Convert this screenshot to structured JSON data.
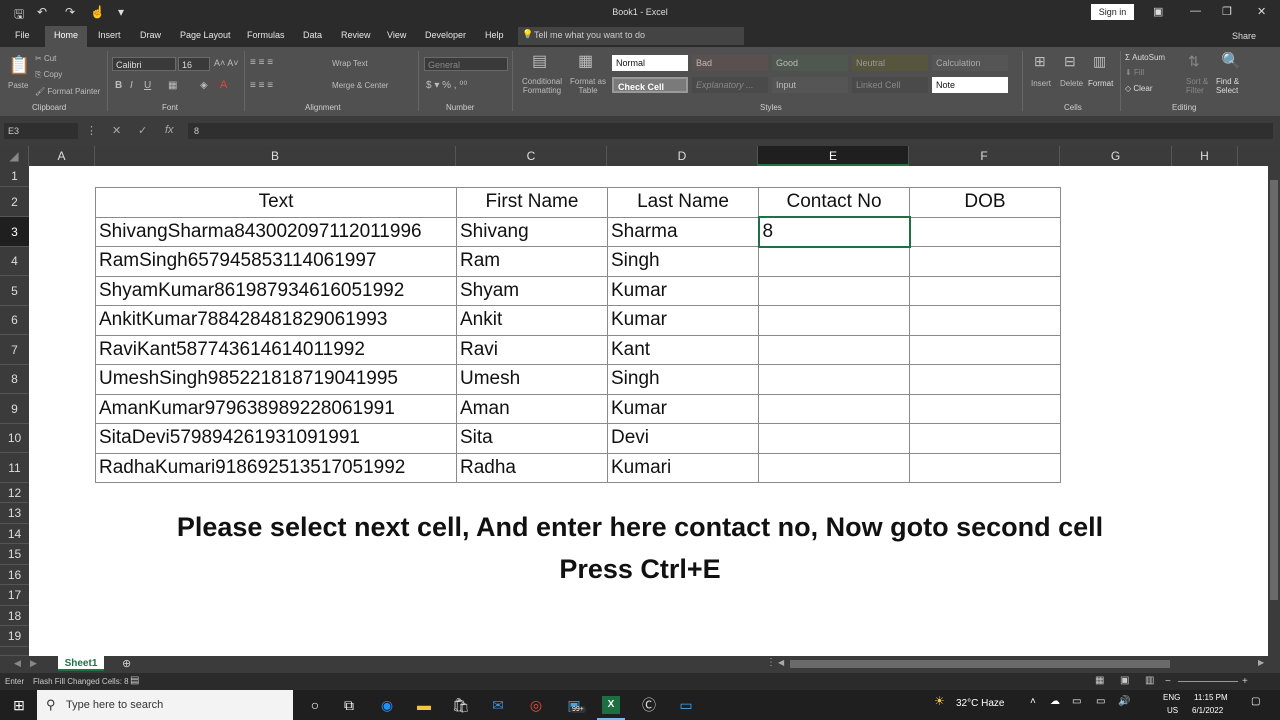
{
  "app": {
    "title": "Book1  -  Excel",
    "signin": "Sign in",
    "share": "Share",
    "tell_me": "Tell me what you want to do"
  },
  "tabs": [
    "File",
    "Home",
    "Insert",
    "Draw",
    "Page Layout",
    "Formulas",
    "Data",
    "Review",
    "View",
    "Developer",
    "Help"
  ],
  "ribbon": {
    "clipboard": {
      "paste": "Paste",
      "cut": "Cut",
      "copy": "Copy",
      "format_painter": "Format Painter",
      "label": "Clipboard"
    },
    "font": {
      "name": "Calibri",
      "size": "16",
      "label": "Font"
    },
    "alignment": {
      "wrap": "Wrap Text",
      "merge": "Merge & Center",
      "label": "Alignment"
    },
    "number": {
      "format": "General",
      "label": "Number"
    },
    "styles": {
      "conditional": "Conditional Formatting",
      "format_as_table": "Format as Table",
      "cells": [
        "Normal",
        "Bad",
        "Good",
        "Neutral",
        "Calculation",
        "Check Cell",
        "Explanatory ...",
        "Input",
        "Linked Cell",
        "Note"
      ],
      "label": "Styles"
    },
    "cells": {
      "insert": "Insert",
      "delete": "Delete",
      "format": "Format",
      "label": "Cells"
    },
    "editing": {
      "autosum": "AutoSum",
      "fill": "Fill",
      "clear": "Clear",
      "sort": "Sort & Filter",
      "find": "Find & Select",
      "label": "Editing"
    }
  },
  "formula_bar": {
    "name_box": "E3",
    "value": "8"
  },
  "columns": [
    "A",
    "B",
    "C",
    "D",
    "E",
    "F",
    "G",
    "H"
  ],
  "rows": [
    "1",
    "2",
    "3",
    "4",
    "5",
    "6",
    "7",
    "8",
    "9",
    "10",
    "11",
    "12",
    "13",
    "14",
    "15",
    "16",
    "17",
    "18",
    "19"
  ],
  "table": {
    "headers": [
      "Text",
      "First Name",
      "Last Name",
      "Contact No",
      "DOB"
    ],
    "rows": [
      [
        "ShivangSharma843002097112011996",
        "Shivang",
        "Sharma",
        "8",
        ""
      ],
      [
        "RamSingh657945853114061997",
        "Ram",
        "Singh",
        "",
        ""
      ],
      [
        "ShyamKumar861987934616051992",
        "Shyam",
        "Kumar",
        "",
        ""
      ],
      [
        "AnkitKumar788428481829061993",
        "Ankit",
        "Kumar",
        "",
        ""
      ],
      [
        "RaviKant587743614614011992",
        "Ravi",
        "Kant",
        "",
        ""
      ],
      [
        "UmeshSingh985221818719041995",
        "Umesh",
        "Singh",
        "",
        ""
      ],
      [
        "AmanKumar979638989228061991",
        "Aman",
        "Kumar",
        "",
        ""
      ],
      [
        "SitaDevi579894261931091991",
        "Sita",
        "Devi",
        "",
        ""
      ],
      [
        "RadhaKumari918692513517051992",
        "Radha",
        "Kumari",
        "",
        ""
      ]
    ]
  },
  "caption": {
    "line1": "Please select next cell, And enter here contact no, Now goto second cell",
    "line2": "Press Ctrl+E"
  },
  "sheet": {
    "tab": "Sheet1"
  },
  "status": {
    "mode": "Enter",
    "message": "Flash Fill Changed Cells: 8"
  },
  "taskbar": {
    "search_placeholder": "Type here to search",
    "weather": "32°C  Haze",
    "lang1": "ENG",
    "lang2": "US",
    "time": "11:15 PM",
    "date": "6/1/2022",
    "badge": "99+"
  },
  "colors": {
    "excel_green": "#207245",
    "dark": "#2b2b2b"
  }
}
